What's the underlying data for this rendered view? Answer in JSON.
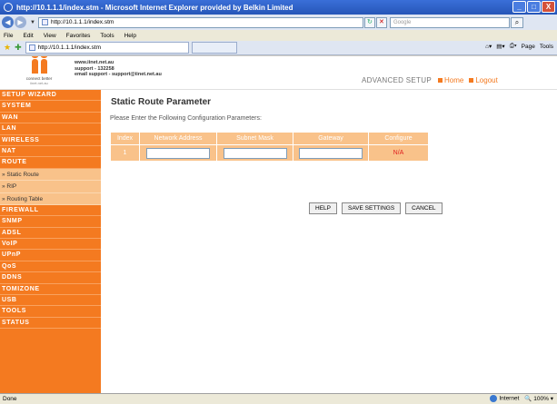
{
  "window": {
    "title": "http://10.1.1.1/index.stm - Microsoft Internet Explorer provided by Belkin Limited",
    "controls": [
      "_",
      "□",
      "X"
    ]
  },
  "address_bar": {
    "url": "http://10.1.1.1/index.stm",
    "search_placeholder": "Google"
  },
  "menu": [
    "File",
    "Edit",
    "View",
    "Favorites",
    "Tools",
    "Help"
  ],
  "tab": {
    "label": "http://10.1.1.1/index.stm"
  },
  "command_bar": {
    "page": "Page",
    "tools": "Tools"
  },
  "header": {
    "logo_tagline": "connect better",
    "logo_site": "iinet.net.au",
    "contact_line1": "www.iinet.net.au",
    "contact_line2": "support - 132258",
    "contact_line3": "email support - support@iinet.net.au",
    "section": "ADVANCED SETUP",
    "home_link": "Home",
    "logout_link": "Logout"
  },
  "sidebar": {
    "items": [
      {
        "label": "SETUP WIZARD"
      },
      {
        "label": "SYSTEM"
      },
      {
        "label": "WAN"
      },
      {
        "label": "LAN"
      },
      {
        "label": "WIRELESS"
      },
      {
        "label": "NAT"
      },
      {
        "label": "ROUTE"
      }
    ],
    "subitems": [
      {
        "label": "» Static Route"
      },
      {
        "label": "» RIP"
      },
      {
        "label": "» Routing Table"
      }
    ],
    "items2": [
      {
        "label": "FIREWALL"
      },
      {
        "label": "SNMP"
      },
      {
        "label": "ADSL"
      },
      {
        "label": "VoIP"
      },
      {
        "label": "UPnP"
      },
      {
        "label": "QoS"
      },
      {
        "label": "DDNS"
      },
      {
        "label": "TOMIZONE"
      },
      {
        "label": "USB"
      },
      {
        "label": "TOOLS"
      },
      {
        "label": "STATUS"
      }
    ]
  },
  "main": {
    "title": "Static Route Parameter",
    "prompt": "Please Enter the Following Configuration Parameters:",
    "columns": [
      "Index",
      "Network Address",
      "Subnet Mask",
      "Gateway",
      "Configure"
    ],
    "row": {
      "index": "1",
      "network_address": "",
      "subnet_mask": "",
      "gateway": "",
      "configure": "N/A"
    },
    "buttons": {
      "help": "HELP",
      "save": "SAVE SETTINGS",
      "cancel": "CANCEL"
    }
  },
  "status_bar": {
    "left": "Done",
    "zone": "Internet",
    "zoom": "100%"
  },
  "colors": {
    "brand_orange": "#f47a20",
    "table_orange": "#f9c28a",
    "na_red": "#e02020"
  }
}
